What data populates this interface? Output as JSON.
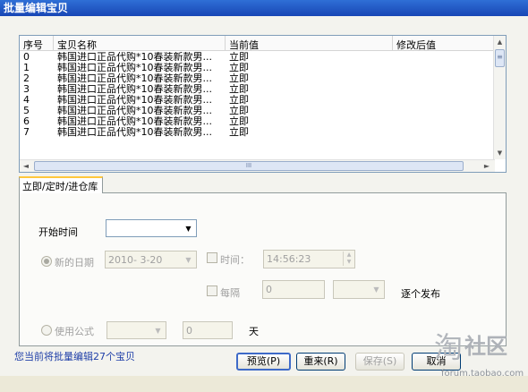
{
  "window": {
    "title": "批量编辑宝贝"
  },
  "list": {
    "columns": [
      "序号",
      "宝贝名称",
      "当前值",
      "修改后值"
    ],
    "rows": [
      {
        "no": "0",
        "name": "韩国进口正品代购*10春装新款男...",
        "current": "立即",
        "new": ""
      },
      {
        "no": "1",
        "name": "韩国进口正品代购*10春装新款男...",
        "current": "立即",
        "new": ""
      },
      {
        "no": "2",
        "name": "韩国进口正品代购*10春装新款男...",
        "current": "立即",
        "new": ""
      },
      {
        "no": "3",
        "name": "韩国进口正品代购*10春装新款男...",
        "current": "立即",
        "new": ""
      },
      {
        "no": "4",
        "name": "韩国进口正品代购*10春装新款男...",
        "current": "立即",
        "new": ""
      },
      {
        "no": "5",
        "name": "韩国进口正品代购*10春装新款男...",
        "current": "立即",
        "new": ""
      },
      {
        "no": "6",
        "name": "韩国进口正品代购*10春装新款男...",
        "current": "立即",
        "new": ""
      },
      {
        "no": "7",
        "name": "韩国进口正品代购*10春装新款男...",
        "current": "立即",
        "new": ""
      }
    ],
    "hscroll_grip": "III"
  },
  "tab": {
    "label": "立即/定时/进仓库"
  },
  "form": {
    "start_time_label": "开始时间",
    "start_time_value": "",
    "new_date_label": "新的日期",
    "date_value": "2010- 3-20",
    "time_label": "时间：",
    "time_value": "14:56:23",
    "interval_label": "每隔",
    "interval_value": "0",
    "interval_unit_value": "",
    "publish_label": "逐个发布",
    "formula_label": "使用公式",
    "formula_select_value": "",
    "formula_value": "0",
    "day_label": "天"
  },
  "status_text": "您当前将批量编辑27个宝贝",
  "buttons": {
    "preview": "预览(P)",
    "reset": "重来(R)",
    "save": "保存(S)",
    "cancel": "取消"
  },
  "watermark": {
    "logo": "淘",
    "text": "社区",
    "url": "forum.taobao.com"
  }
}
